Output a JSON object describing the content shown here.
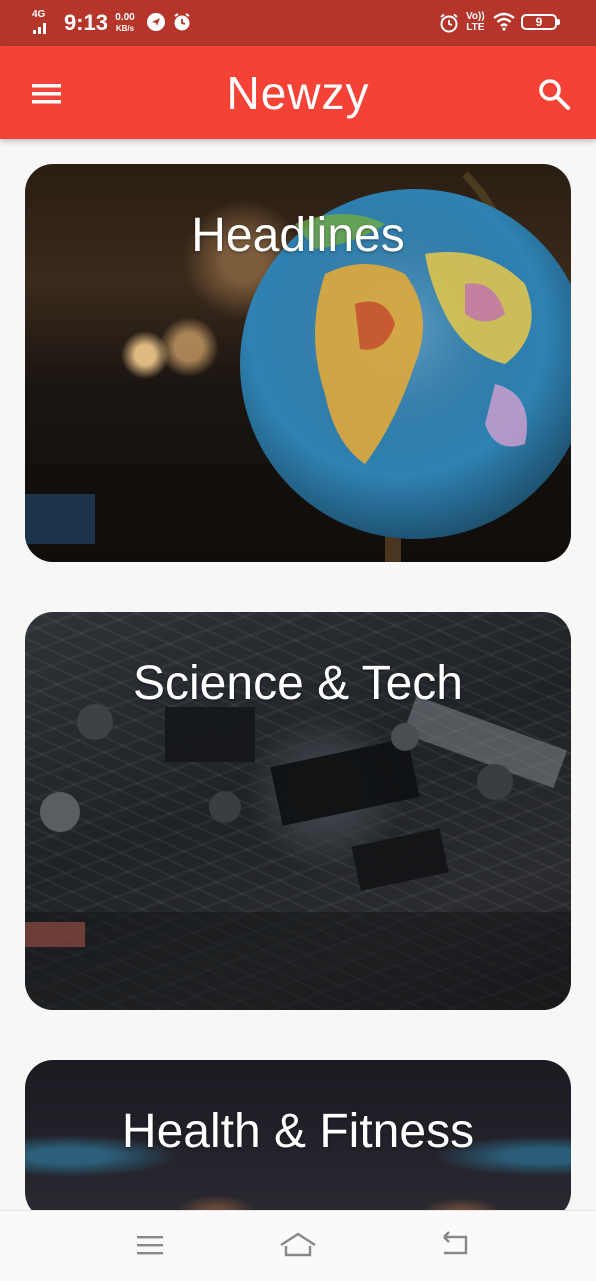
{
  "status_bar": {
    "network": "4G",
    "time": "9:13",
    "speed_value": "0.00",
    "speed_unit": "KB/s",
    "volte_top": "Vo))",
    "volte_bottom": "LTE",
    "battery": "9",
    "icons": [
      "signal-icon",
      "location-icon",
      "alarm-icon",
      "alarm-icon",
      "wifi-icon",
      "battery-icon"
    ]
  },
  "app_bar": {
    "title": "Newzy",
    "icons": [
      "menu-icon",
      "search-icon"
    ]
  },
  "cards": [
    {
      "title": "Headlines",
      "image": "globe-photo"
    },
    {
      "title": "Science & Tech",
      "image": "circuit-board-photo"
    },
    {
      "title": "Health & Fitness",
      "image": "fitness-photo"
    }
  ],
  "nav_bar": {
    "icons": [
      "menu-lines-icon",
      "home-icon",
      "back-icon"
    ]
  },
  "colors": {
    "status_bar": "#b5352b",
    "app_bar": "#f44336",
    "background": "#f7f7f7"
  }
}
